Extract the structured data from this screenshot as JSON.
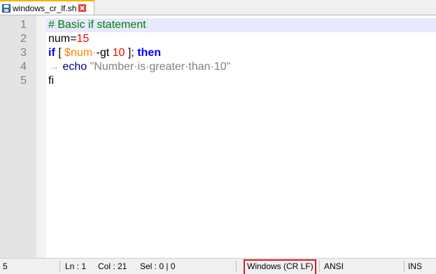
{
  "tab": {
    "filename": "windows_cr_lf.sh"
  },
  "editor": {
    "line_numbers": [
      "1",
      "2",
      "3",
      "4",
      "5"
    ],
    "lines": [
      [
        {
          "text": "# Basic if statement",
          "type": "comment"
        }
      ],
      [
        {
          "text": "num=",
          "type": "plain"
        },
        {
          "text": "15",
          "type": "number"
        }
      ],
      [
        {
          "text": "if",
          "type": "keyword"
        },
        {
          "text": " [ ",
          "type": "plain"
        },
        {
          "text": "$num",
          "type": "var"
        },
        {
          "text": "·",
          "type": "ws"
        },
        {
          "text": "-gt ",
          "type": "plain"
        },
        {
          "text": "10",
          "type": "number"
        },
        {
          "text": " ]; ",
          "type": "plain"
        },
        {
          "text": "then",
          "type": "keyword"
        }
      ],
      [
        {
          "text": "→ ",
          "type": "ws"
        },
        {
          "text": "echo",
          "type": "echo"
        },
        {
          "text": " ",
          "type": "plain"
        },
        {
          "text": "\"Number·is·greater·than·10\"",
          "type": "string"
        }
      ],
      [
        {
          "text": "fi",
          "type": "plain"
        }
      ]
    ]
  },
  "statusbar": {
    "lines_count": "5",
    "line": "Ln : 1",
    "col": "Col : 21",
    "sel": "Sel : 0 | 0",
    "eol": "Windows (CR LF)",
    "encoding": "ANSI",
    "mode": "INS"
  },
  "colors": {
    "eol_highlight": "#d11f1f",
    "current_line": "#e8e8ff",
    "tab_accent": "#f7b000"
  },
  "icons": {
    "tab_icon": "floppy-save-icon",
    "close_icon": "close-icon"
  }
}
